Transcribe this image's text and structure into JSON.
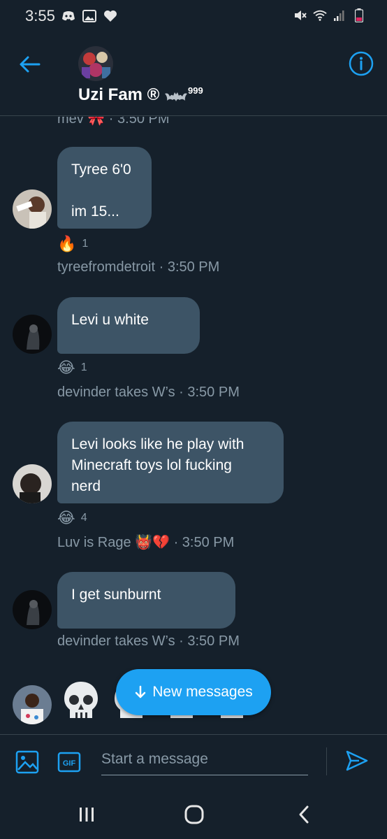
{
  "status_bar": {
    "time": "3:55",
    "left_icons": [
      "discord-icon",
      "image-icon",
      "heart-icon"
    ],
    "right_icons": [
      "mute-icon",
      "wifi-icon",
      "signal-icon",
      "battery-icon"
    ]
  },
  "header": {
    "title": "Uzi Fam ®",
    "title_suffix": "999",
    "back_icon": "arrow-left-icon",
    "info_icon": "info-icon"
  },
  "conversation": {
    "cut_meta": "mev 🎀 · 3:50 PM",
    "messages": [
      {
        "lines": [
          "Tyree 6'0",
          "",
          "im 15..."
        ],
        "reaction": {
          "emoji": "🔥",
          "count": "1"
        },
        "meta": "tyreefromdetroit · 3:50 PM"
      },
      {
        "lines": [
          "Levi u white"
        ],
        "reaction": {
          "emoji": "😂",
          "count": "1"
        },
        "meta": "devinder takes W’s · 3:50 PM"
      },
      {
        "lines": [
          "Levi looks like he play with",
          "Minecraft toys lol fucking",
          "nerd"
        ],
        "reaction": {
          "emoji": "😂",
          "count": "4"
        },
        "meta_name": "Luv is Rage",
        "meta_emoji": "👹💔",
        "meta_time": "· 3:50 PM"
      },
      {
        "lines": [
          "I get sunburnt"
        ],
        "meta": "devinder takes W’s · 3:50 PM"
      }
    ],
    "last_message_emoji": "💀💀💀💀",
    "new_messages_label": "New messages"
  },
  "composer": {
    "placeholder": "Start a message",
    "gif_label": "GIF"
  },
  "colors": {
    "background": "#15202b",
    "bubble": "#3d5466",
    "accent": "#1da1f2",
    "secondary_text": "#8899a6"
  }
}
